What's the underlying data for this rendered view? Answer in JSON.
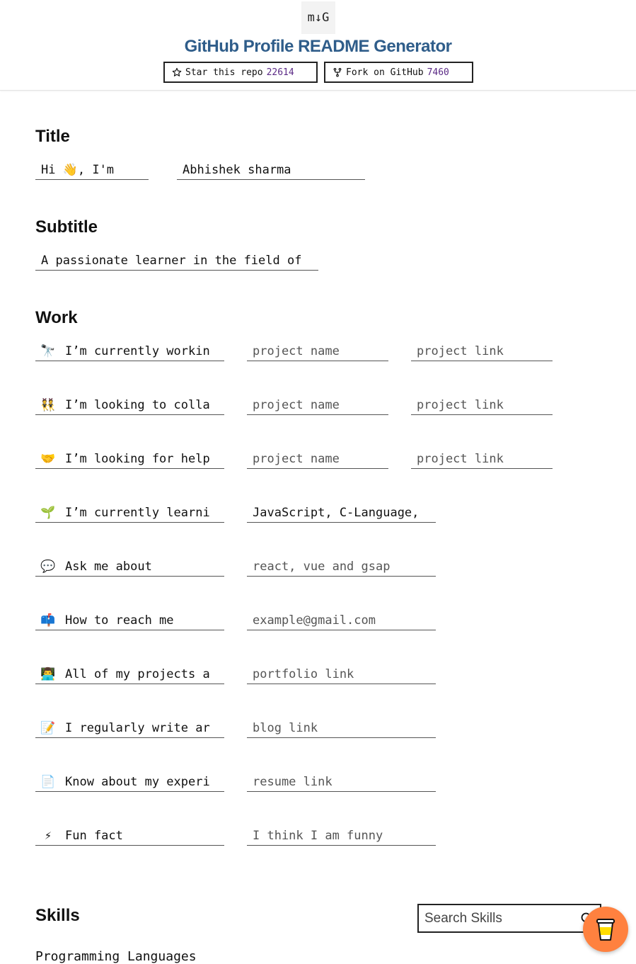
{
  "header": {
    "logo_text": "m↓G",
    "title": "GitHub Profile README Generator",
    "star_label": "Star this repo",
    "star_count": "22614",
    "fork_label": "Fork on GitHub",
    "fork_count": "7460"
  },
  "title_section": {
    "heading": "Title",
    "prefix_value": "Hi 👋, I'm",
    "name_value": "Abhishek sharma"
  },
  "subtitle_section": {
    "heading": "Subtitle",
    "value": "A passionate learner in the field of"
  },
  "work_section": {
    "heading": "Work",
    "rows": [
      {
        "icon": "telescope-icon",
        "emoji": "🔭",
        "label": "I’m currently workin",
        "project_placeholder": "project name",
        "link_placeholder": "project link"
      },
      {
        "icon": "people-icon",
        "emoji": "👯",
        "label": "I’m looking to colla",
        "project_placeholder": "project name",
        "link_placeholder": "project link"
      },
      {
        "icon": "handshake-icon",
        "emoji": "🤝",
        "label": "I’m looking for help",
        "project_placeholder": "project name",
        "link_placeholder": "project link"
      },
      {
        "icon": "seedling-icon",
        "emoji": "🌱",
        "label": "I’m currently learni",
        "value": "JavaScript, C-Language,"
      },
      {
        "icon": "speech-bubble-icon",
        "emoji": "💬",
        "label": "Ask me about",
        "placeholder": "react, vue and gsap"
      },
      {
        "icon": "mailbox-icon",
        "emoji": "📫",
        "label": "How to reach me",
        "placeholder": "example@gmail.com"
      },
      {
        "icon": "technologist-icon",
        "emoji": "👨‍💻",
        "label": "All of my projects a",
        "placeholder": "portfolio link"
      },
      {
        "icon": "memo-icon",
        "emoji": "📝",
        "label": "I regularly write ar",
        "placeholder": "blog link"
      },
      {
        "icon": "document-icon",
        "emoji": "📄",
        "label": "Know about my experi",
        "placeholder": "resume link"
      },
      {
        "icon": "lightning-icon",
        "emoji": "⚡",
        "label": "Fun fact",
        "placeholder": "I think I am funny"
      }
    ]
  },
  "skills_section": {
    "heading": "Skills",
    "search_placeholder": "Search Skills",
    "category": "Programming Languages"
  },
  "colors": {
    "title_blue": "#2f5d8a",
    "count_purple": "#5b2a86",
    "coffee_orange": "#ff813f"
  }
}
